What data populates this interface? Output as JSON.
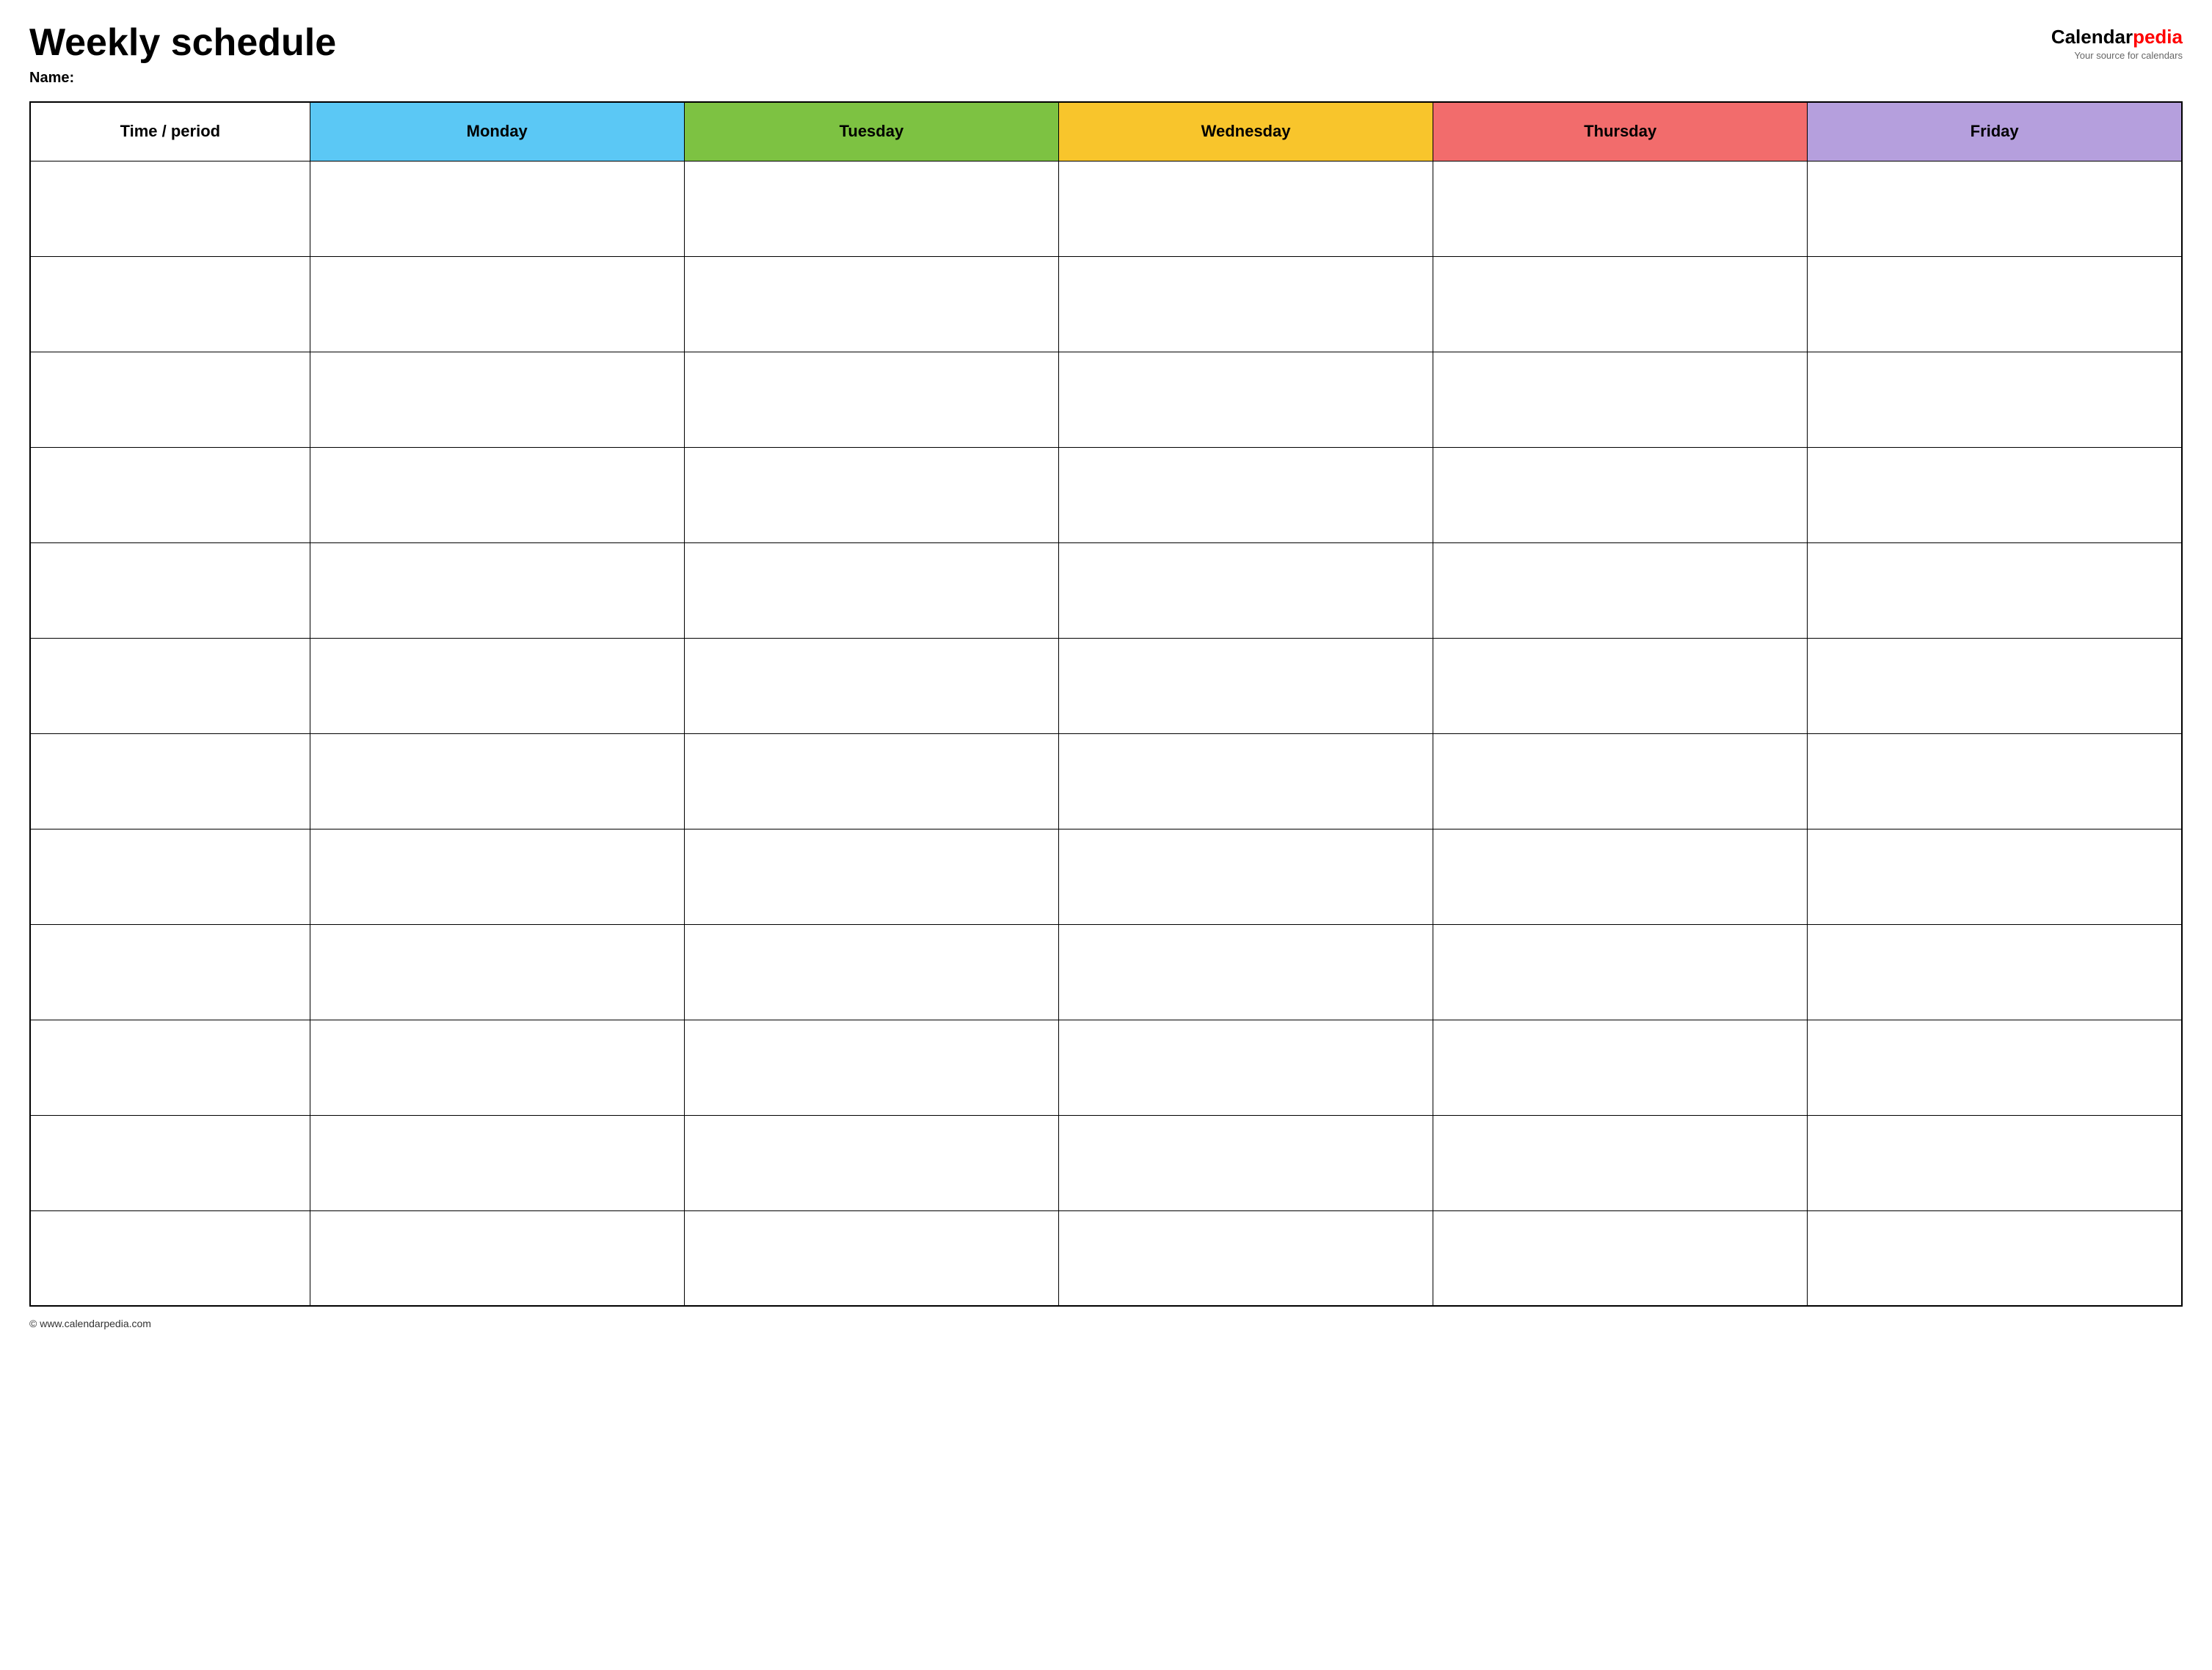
{
  "header": {
    "main_title": "Weekly schedule",
    "name_label": "Name:",
    "logo": {
      "calendar_text": "Calendar",
      "pedia_text": "pedia",
      "tagline": "Your source for calendars"
    }
  },
  "table": {
    "columns": [
      {
        "label": "Time / period",
        "class": "th-time"
      },
      {
        "label": "Monday",
        "class": "th-monday"
      },
      {
        "label": "Tuesday",
        "class": "th-tuesday"
      },
      {
        "label": "Wednesday",
        "class": "th-wednesday"
      },
      {
        "label": "Thursday",
        "class": "th-thursday"
      },
      {
        "label": "Friday",
        "class": "th-friday"
      }
    ],
    "row_count": 12
  },
  "footer": {
    "copyright": "© www.calendarpedia.com"
  }
}
